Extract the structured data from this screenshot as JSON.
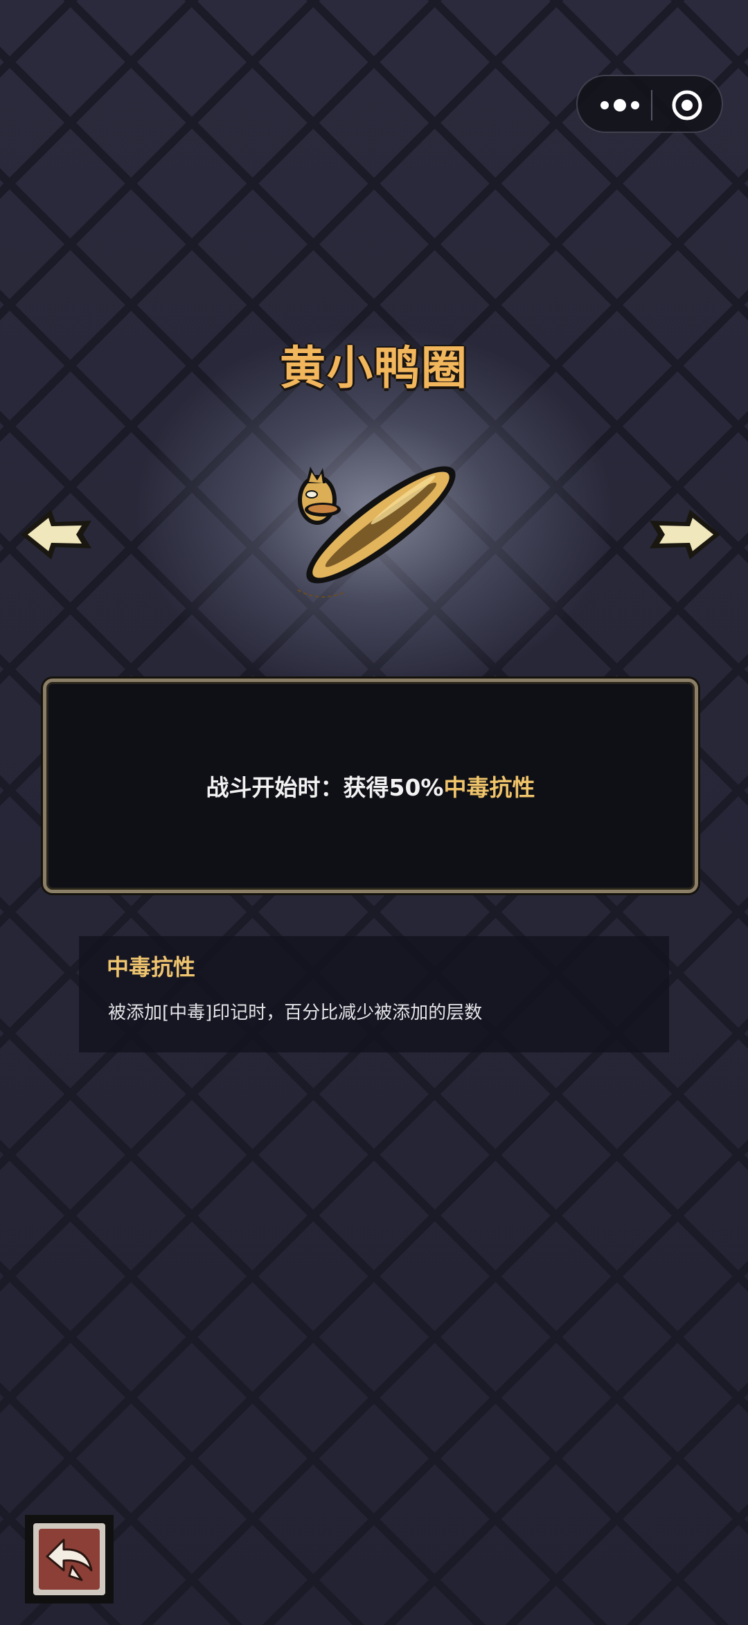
{
  "capsule": {
    "more_icon": "more-dots-icon",
    "close_icon": "target-circle-icon"
  },
  "item": {
    "name": "黄小鸭圈",
    "art_icon": "yellow-duck-swim-ring",
    "effect_prefix": "战斗开始时：获得50%",
    "effect_highlight": "中毒抗性"
  },
  "keyword": {
    "name": "中毒抗性",
    "description": "被添加[中毒]印记时，百分比减少被添加的层数"
  },
  "nav": {
    "prev_icon": "arrow-left-icon",
    "next_icon": "arrow-right-icon",
    "back_icon": "return-arrow-icon"
  },
  "colors": {
    "title": "#f2b65c",
    "highlight": "#f0c46a",
    "frame": "#8c7f67",
    "back_button": "#8b3f36"
  }
}
